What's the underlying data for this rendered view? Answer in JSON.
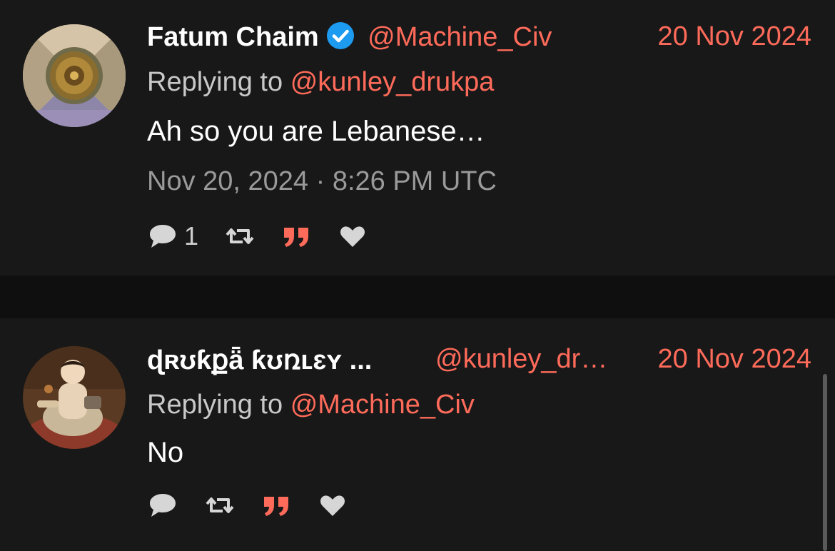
{
  "tweets": [
    {
      "author_name": "Fatum Chaim",
      "verified": true,
      "handle": "@Machine_Civ",
      "date": "20 Nov 2024",
      "replying_label": "Replying to",
      "replying_to": "@kunley_drukpa",
      "text": "Ah so you are Lebanese…",
      "timestamp": "Nov 20, 2024 · 8:26 PM UTC",
      "stats": {
        "replies": "1"
      },
      "avatar_icon": "gilded-dome-avatar"
    },
    {
      "author_name": "ɖʀʊƙքǟ ƙʊռʟɛʏ ...",
      "verified": false,
      "handle": "@kunley_dr…",
      "date": "20 Nov 2024",
      "replying_label": "Replying to",
      "replying_to": "@Machine_Civ",
      "text": "No",
      "stats": {
        "replies": ""
      },
      "avatar_icon": "thangka-painting-avatar"
    }
  ],
  "icons": {
    "reply": "comment-icon",
    "retweet": "retweet-icon",
    "quote": "quote-icon",
    "like": "heart-icon"
  },
  "colors": {
    "accent": "#ff6b5a",
    "background": "#0f0f0f",
    "card": "#181818",
    "verified": "#1d9bf0"
  }
}
